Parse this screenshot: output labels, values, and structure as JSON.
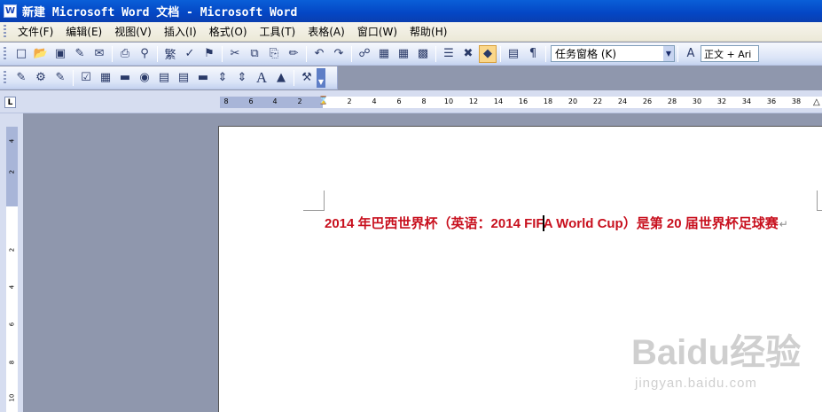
{
  "window": {
    "title": "新建 Microsoft Word 文档 - Microsoft Word",
    "app_icon": "W"
  },
  "menu": {
    "items": [
      "文件(F)",
      "编辑(E)",
      "视图(V)",
      "插入(I)",
      "格式(O)",
      "工具(T)",
      "表格(A)",
      "窗口(W)",
      "帮助(H)"
    ]
  },
  "toolbar": {
    "task_pane_label": "任务窗格 (K)",
    "style_value": "正文 + Ari"
  },
  "icons": {
    "standard": [
      "new-icon",
      "open-icon",
      "save-icon",
      "permission-icon",
      "email-icon",
      "print-icon",
      "print-preview-icon",
      "traditional-chinese-icon",
      "spelling-icon",
      "research-icon",
      "cut-icon",
      "copy-icon",
      "paste-icon",
      "format-painter-icon",
      "undo-icon",
      "redo-icon",
      "hyperlink-icon",
      "tables-borders-icon",
      "insert-table-icon",
      "insert-excel-icon",
      "columns-icon",
      "drawing-icon",
      "document-map-icon",
      "show-hide-icon",
      "read-icon",
      "styles-icon"
    ],
    "forms": [
      "design-mode-icon",
      "properties-icon",
      "view-code-icon",
      "checkbox-icon",
      "textbox-icon",
      "command-button-icon",
      "option-button-icon",
      "listbox-icon",
      "combobox-icon",
      "toggle-button-icon",
      "spin-button-icon",
      "scrollbar-icon",
      "label-icon",
      "image-icon",
      "more-controls-icon"
    ]
  },
  "ruler": {
    "ticks": [
      "8",
      "6",
      "4",
      "2",
      "",
      "2",
      "4",
      "6",
      "8",
      "10",
      "12",
      "14",
      "16",
      "18",
      "20",
      "22",
      "24",
      "26",
      "28",
      "30",
      "32",
      "34",
      "36",
      "38"
    ],
    "vticks": [
      "4",
      "2",
      "",
      "2",
      "4",
      "6",
      "8",
      "10"
    ]
  },
  "document": {
    "text": "2014 年巴西世界杯（英语：2014 FIFA World Cup）是第 20 届世界杯足球赛",
    "paragraph_mark": "↵",
    "text_color": "#c8101e"
  },
  "watermark": {
    "brand": "Baidu经验",
    "url": "jingyan.baidu.com"
  }
}
